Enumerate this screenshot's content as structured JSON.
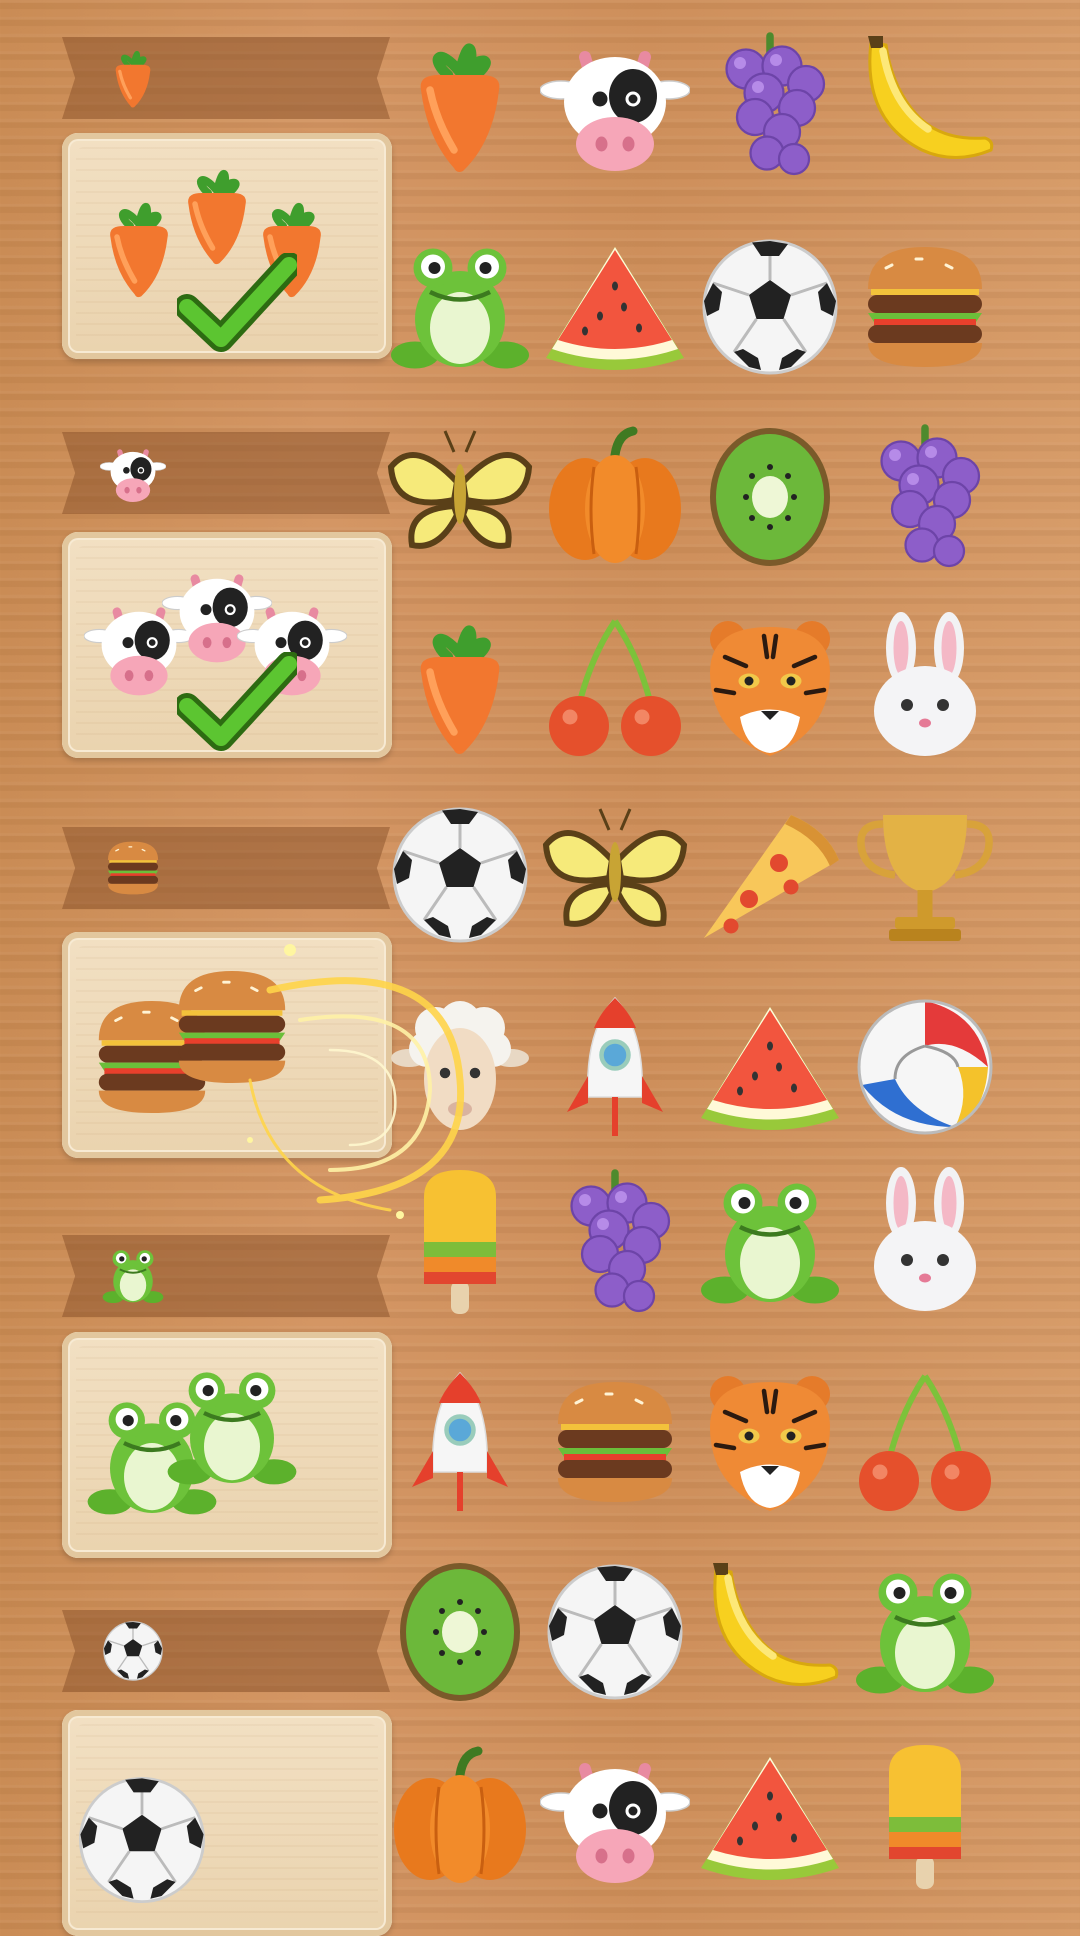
{
  "goals": [
    {
      "item": "carrot",
      "count": "3/3",
      "complete": true
    },
    {
      "item": "cow",
      "count": "3/3",
      "complete": true
    },
    {
      "item": "burger",
      "count": "2/3",
      "complete": false
    },
    {
      "item": "frog",
      "count": "2/3",
      "complete": false
    },
    {
      "item": "soccer-ball",
      "count": "1/3",
      "complete": false
    }
  ],
  "board": [
    [
      "carrot",
      "cow",
      "grapes",
      "banana"
    ],
    [
      "frog",
      "watermelon",
      "soccer-ball",
      "burger"
    ],
    [
      "butterfly",
      "pumpkin",
      "kiwi",
      "grapes"
    ],
    [
      "carrot",
      "cherries",
      "tiger",
      "rabbit"
    ],
    [
      "soccer-ball",
      "butterfly",
      "pizza",
      "trophy"
    ],
    [
      "sheep",
      "rocket",
      "watermelon",
      "volleyball"
    ],
    [
      "popsicle",
      "grapes",
      "frog",
      "rabbit"
    ],
    [
      "rocket",
      "burger",
      "tiger",
      "cherries"
    ],
    [
      "kiwi",
      "soccer-ball",
      "banana",
      "frog"
    ],
    [
      "pumpkin",
      "cow",
      "watermelon",
      "popsicle"
    ]
  ],
  "colors": {
    "wood": "#d1915d",
    "ribbon": "#8a5028",
    "tray": "#eed9b6",
    "check": "#5cc531"
  }
}
